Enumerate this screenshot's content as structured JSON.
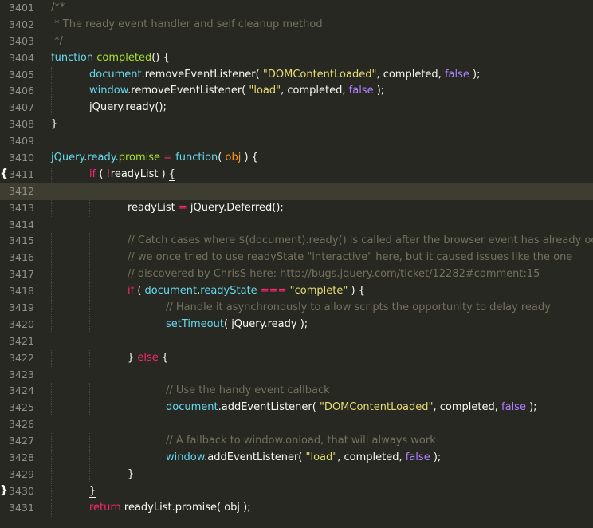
{
  "theme": {
    "background": "#272822",
    "active_line": "#3e3d32",
    "gutter_text": "#90908a",
    "comment": "#75715e",
    "keyword": "#f92672",
    "storage": "#66d9ef",
    "function": "#a6e22e",
    "string": "#e6db74",
    "constant": "#ae81ff",
    "parameter": "#fd971f",
    "plain": "#f8f8f2"
  },
  "lines": [
    {
      "num": "3401",
      "indent": 0,
      "tokens": [
        [
          "c",
          "/**"
        ]
      ]
    },
    {
      "num": "3402",
      "indent": 0,
      "tokens": [
        [
          "c",
          " * The ready event handler and self cleanup method"
        ]
      ]
    },
    {
      "num": "3403",
      "indent": 0,
      "tokens": [
        [
          "c",
          " */"
        ]
      ]
    },
    {
      "num": "3404",
      "indent": 0,
      "tokens": [
        [
          "s",
          "function"
        ],
        [
          "p",
          " "
        ],
        [
          "f",
          "completed"
        ],
        [
          "p",
          "() {"
        ]
      ]
    },
    {
      "num": "3405",
      "indent": 1,
      "tokens": [
        [
          "s",
          "document"
        ],
        [
          "p",
          "."
        ],
        [
          "p",
          "removeEventListener"
        ],
        [
          "p",
          "( "
        ],
        [
          "str",
          "\"DOMContentLoaded\""
        ],
        [
          "p",
          ", completed, "
        ],
        [
          "k2",
          "false"
        ],
        [
          "p",
          " );"
        ]
      ]
    },
    {
      "num": "3406",
      "indent": 1,
      "tokens": [
        [
          "s",
          "window"
        ],
        [
          "p",
          ".removeEventListener( "
        ],
        [
          "str",
          "\"load\""
        ],
        [
          "p",
          ", completed, "
        ],
        [
          "k2",
          "false"
        ],
        [
          "p",
          " );"
        ]
      ]
    },
    {
      "num": "3407",
      "indent": 1,
      "tokens": [
        [
          "p",
          "jQuery.ready();"
        ]
      ]
    },
    {
      "num": "3408",
      "indent": 0,
      "tokens": [
        [
          "p",
          "}"
        ]
      ]
    },
    {
      "num": "3409",
      "indent": 0,
      "tokens": []
    },
    {
      "num": "3410",
      "indent": 0,
      "tokens": [
        [
          "s",
          "jQuery"
        ],
        [
          "p",
          "."
        ],
        [
          "s",
          "ready"
        ],
        [
          "p",
          "."
        ],
        [
          "f",
          "promise"
        ],
        [
          "p",
          " "
        ],
        [
          "k",
          "="
        ],
        [
          "p",
          " "
        ],
        [
          "s",
          "function"
        ],
        [
          "p",
          "( "
        ],
        [
          "param",
          "obj"
        ],
        [
          "p",
          " ) {"
        ]
      ]
    },
    {
      "num": "3411",
      "indent": 1,
      "fold": "{",
      "tokens": [
        [
          "k",
          "if"
        ],
        [
          "p",
          " ( "
        ],
        [
          "k",
          "!"
        ],
        [
          "p",
          "readyList ) "
        ],
        [
          "u",
          "{"
        ]
      ]
    },
    {
      "num": "3412",
      "indent": 0,
      "active": true,
      "tokens": []
    },
    {
      "num": "3413",
      "indent": 2,
      "tokens": [
        [
          "p",
          "readyList "
        ],
        [
          "k",
          "="
        ],
        [
          "p",
          " jQuery.Deferred();"
        ]
      ]
    },
    {
      "num": "3414",
      "indent": 0,
      "tokens": []
    },
    {
      "num": "3415",
      "indent": 2,
      "tokens": [
        [
          "c",
          "// Catch cases where $(document).ready() is called after the browser event has already occurred."
        ]
      ]
    },
    {
      "num": "3416",
      "indent": 2,
      "tokens": [
        [
          "c",
          "// we once tried to use readyState \"interactive\" here, but it caused issues like the one"
        ]
      ]
    },
    {
      "num": "3417",
      "indent": 2,
      "tokens": [
        [
          "c",
          "// discovered by ChrisS here: http://bugs.jquery.com/ticket/12282#comment:15"
        ]
      ]
    },
    {
      "num": "3418",
      "indent": 2,
      "tokens": [
        [
          "k",
          "if"
        ],
        [
          "p",
          " ( "
        ],
        [
          "s",
          "document"
        ],
        [
          "p",
          "."
        ],
        [
          "s",
          "readyState"
        ],
        [
          "p",
          " "
        ],
        [
          "k",
          "==="
        ],
        [
          "p",
          " "
        ],
        [
          "str",
          "\"complete\""
        ],
        [
          "p",
          " ) {"
        ]
      ]
    },
    {
      "num": "3419",
      "indent": 3,
      "tokens": [
        [
          "c",
          "// Handle it asynchronously to allow scripts the opportunity to delay ready"
        ]
      ]
    },
    {
      "num": "3420",
      "indent": 3,
      "tokens": [
        [
          "s",
          "setTimeout"
        ],
        [
          "p",
          "( jQuery.ready );"
        ]
      ]
    },
    {
      "num": "3421",
      "indent": 0,
      "tokens": []
    },
    {
      "num": "3422",
      "indent": 2,
      "tokens": [
        [
          "p",
          "} "
        ],
        [
          "k",
          "else"
        ],
        [
          "p",
          " {"
        ]
      ]
    },
    {
      "num": "3423",
      "indent": 0,
      "tokens": []
    },
    {
      "num": "3424",
      "indent": 3,
      "tokens": [
        [
          "c",
          "// Use the handy event callback"
        ]
      ]
    },
    {
      "num": "3425",
      "indent": 3,
      "tokens": [
        [
          "s",
          "document"
        ],
        [
          "p",
          ".addEventListener( "
        ],
        [
          "str",
          "\"DOMContentLoaded\""
        ],
        [
          "p",
          ", completed, "
        ],
        [
          "k2",
          "false"
        ],
        [
          "p",
          " );"
        ]
      ]
    },
    {
      "num": "3426",
      "indent": 0,
      "tokens": []
    },
    {
      "num": "3427",
      "indent": 3,
      "tokens": [
        [
          "c",
          "// A fallback to window.onload, that will always work"
        ]
      ]
    },
    {
      "num": "3428",
      "indent": 3,
      "tokens": [
        [
          "s",
          "window"
        ],
        [
          "p",
          ".addEventListener( "
        ],
        [
          "str",
          "\"load\""
        ],
        [
          "p",
          ", completed, "
        ],
        [
          "k2",
          "false"
        ],
        [
          "p",
          " );"
        ]
      ]
    },
    {
      "num": "3429",
      "indent": 2,
      "tokens": [
        [
          "p",
          "}"
        ]
      ]
    },
    {
      "num": "3430",
      "indent": 1,
      "fold": "}",
      "tokens": [
        [
          "u",
          "}"
        ]
      ]
    },
    {
      "num": "3431",
      "indent": 1,
      "tokens": [
        [
          "k",
          "return"
        ],
        [
          "p",
          " readyList.promise( obj );"
        ]
      ]
    }
  ]
}
